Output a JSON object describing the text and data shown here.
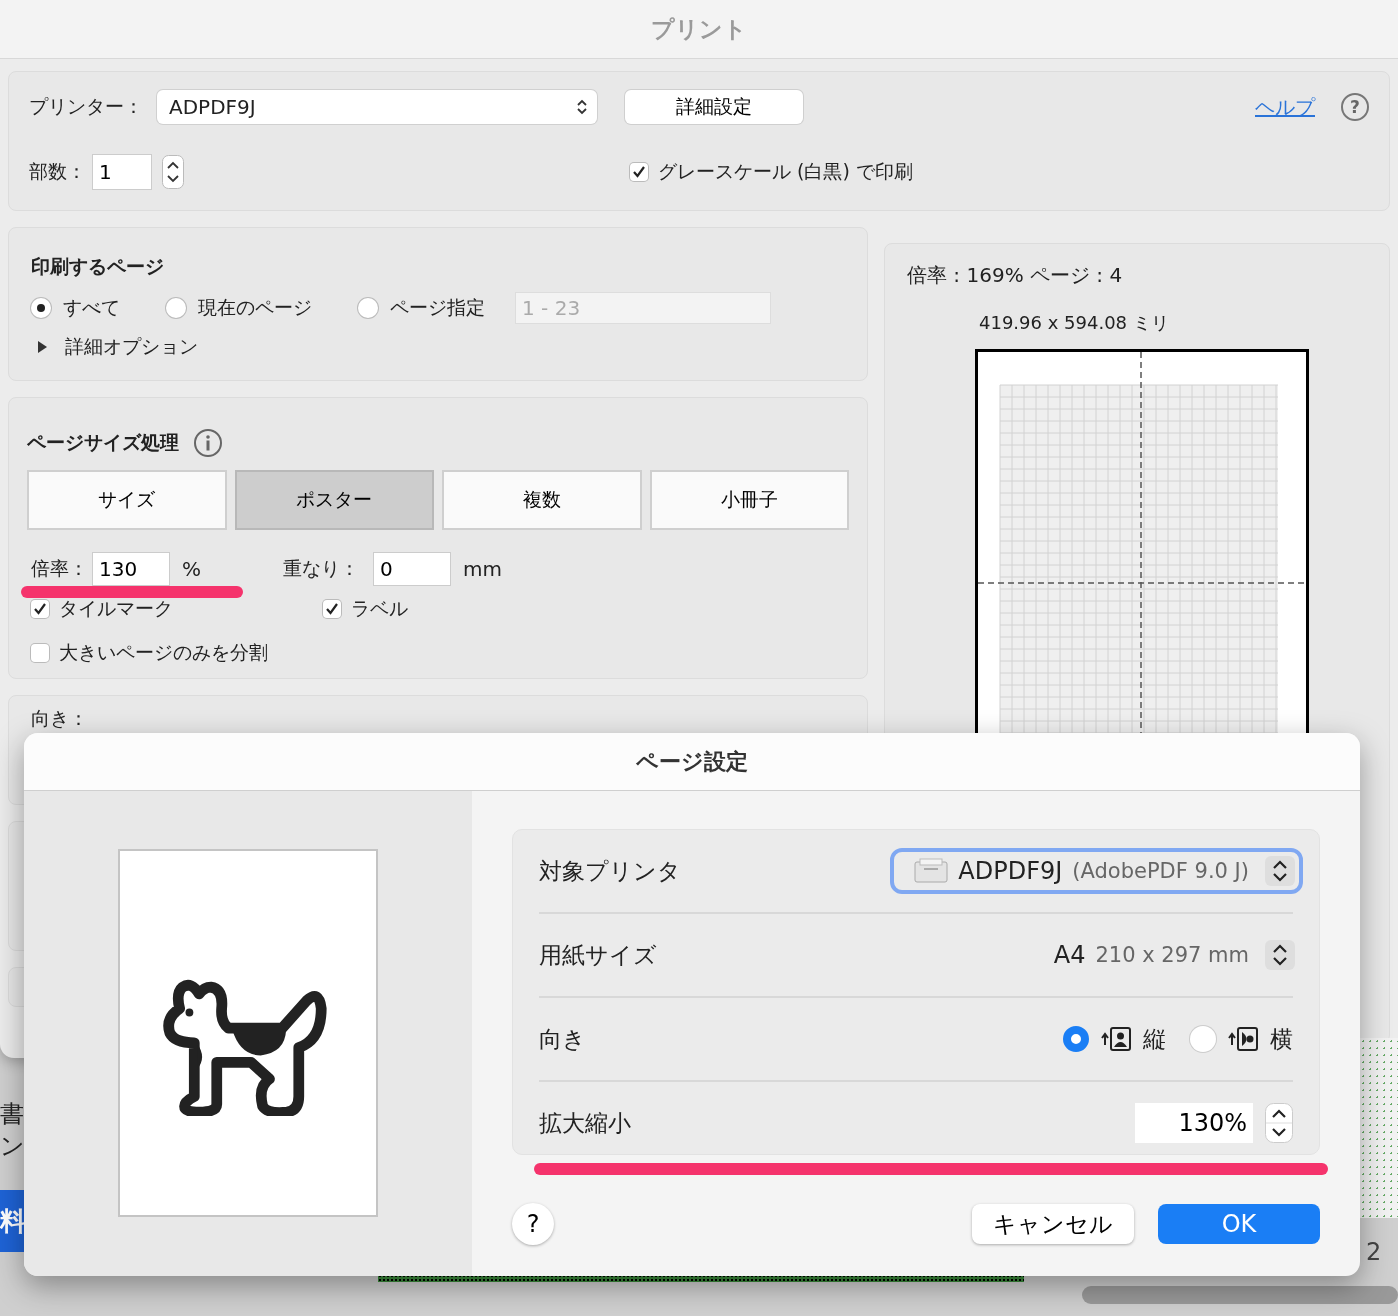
{
  "print_window": {
    "title": "プリント",
    "printer": {
      "label": "プリンター：",
      "value": "ADPDF9J"
    },
    "details_button": "詳細設定",
    "help_link": "ヘルプ",
    "help_button": "?",
    "copies": {
      "label": "部数：",
      "value": "1"
    },
    "grayscale": {
      "label": "グレースケール (白黒) で印刷",
      "checked": true
    },
    "pages_section": {
      "title": "印刷するページ",
      "options": [
        {
          "label": "すべて",
          "selected": true
        },
        {
          "label": "現在のページ",
          "selected": false
        },
        {
          "label": "ページ指定",
          "selected": false
        }
      ],
      "range_placeholder": "1 - 23",
      "more_options": "詳細オプション"
    },
    "page_size_section": {
      "title": "ページサイズ処理",
      "tabs": [
        {
          "label": "サイズ",
          "selected": false
        },
        {
          "label": "ポスター",
          "selected": true
        },
        {
          "label": "複数",
          "selected": false
        },
        {
          "label": "小冊子",
          "selected": false
        }
      ],
      "scale": {
        "label": "倍率：",
        "value": "130",
        "unit": "%"
      },
      "overlap": {
        "label": "重なり：",
        "value": "0",
        "unit": "mm"
      },
      "checkboxes": [
        {
          "label": "タイルマーク",
          "checked": true
        },
        {
          "label": "ラベル",
          "checked": true
        },
        {
          "label": "大きいページのみを分割",
          "checked": false
        }
      ]
    },
    "orientation_label": "向き：",
    "preview": {
      "scale_info": "倍率 : 169% ページ : 4",
      "dimensions": "419.96 x 594.08 ミリ"
    }
  },
  "background": {
    "left_fragments": [
      "書",
      "ン"
    ],
    "blue_tab": "料",
    "page_number": "2"
  },
  "page_setup_dialog": {
    "title": "ページ設定",
    "rows": [
      {
        "kind": "popup",
        "label": "対象プリンタ",
        "value": "ADPDF9J",
        "detail": "(AdobePDF 9.0 J)",
        "focused": true
      },
      {
        "kind": "popup",
        "label": "用紙サイズ",
        "value": "A4",
        "detail": "210 x 297 mm",
        "focused": false
      },
      {
        "kind": "orientation",
        "label": "向き",
        "options": [
          {
            "label": "縦",
            "selected": true
          },
          {
            "label": "横",
            "selected": false
          }
        ]
      },
      {
        "kind": "stepper",
        "label": "拡大縮小",
        "value": "130%"
      }
    ],
    "help_button": "?",
    "cancel": "キャンセル",
    "ok": "OK"
  }
}
